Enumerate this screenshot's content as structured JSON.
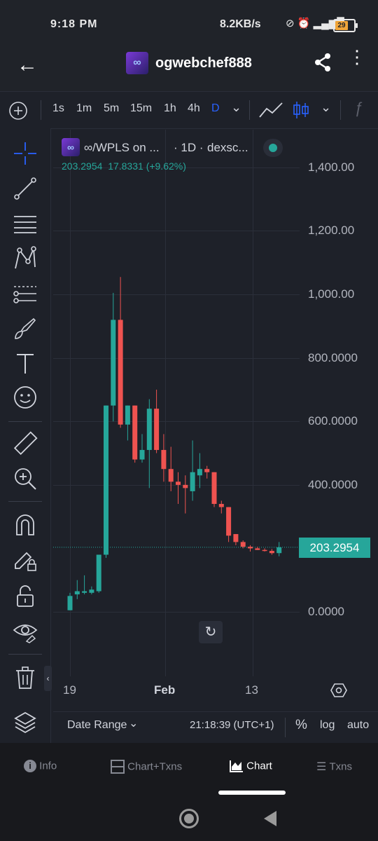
{
  "status": {
    "time": "9:18 PM",
    "network_speed": "8.2KB/s",
    "battery": "29"
  },
  "header": {
    "title": "ogwebchef888",
    "logo_text": "∞"
  },
  "toolbar": {
    "intervals": [
      "1s",
      "1m",
      "5m",
      "15m",
      "1h",
      "4h",
      "D"
    ],
    "active_interval": "D"
  },
  "legend": {
    "symbol": "∞/WPLS on ...",
    "interval": "· 1D ·",
    "source": "dexsc...",
    "last": "203.2954",
    "change": "17.8331",
    "change_pct": "(+9.62%)"
  },
  "price_tag": "203.2954",
  "bottom_bar": {
    "date_range": "Date Range",
    "clock": "21:18:39 (UTC+1)",
    "percent": "%",
    "log": "log",
    "auto": "auto"
  },
  "nav": {
    "info": "Info",
    "chart_txns": "Chart+Txns",
    "chart": "Chart",
    "txns": "Txns"
  },
  "colors": {
    "up": "#26a69a",
    "down": "#ef5350",
    "active_interval": "#2962ff"
  },
  "chart_data": {
    "type": "candlestick",
    "x_tick_labels": [
      "19",
      "Feb",
      "13"
    ],
    "y_tick_labels": [
      "1,400.00",
      "1,200.00",
      "1,000.00",
      "800.0000",
      "600.0000",
      "400.0000",
      "0.0000"
    ],
    "ylim": [
      0,
      1400
    ],
    "last_price": 203.2954,
    "candles": [
      {
        "o": 5,
        "h": 60,
        "l": 5,
        "c": 50
      },
      {
        "o": 55,
        "h": 100,
        "l": 40,
        "c": 65
      },
      {
        "o": 60,
        "h": 115,
        "l": 55,
        "c": 65
      },
      {
        "o": 60,
        "h": 80,
        "l": 55,
        "c": 70
      },
      {
        "o": 65,
        "h": 180,
        "l": 60,
        "c": 180
      },
      {
        "o": 180,
        "h": 300,
        "l": 170,
        "c": 650
      },
      {
        "o": 650,
        "h": 1005,
        "l": 600,
        "c": 920
      },
      {
        "o": 920,
        "h": 1055,
        "l": 580,
        "c": 590
      },
      {
        "o": 590,
        "h": 650,
        "l": 540,
        "c": 650
      },
      {
        "o": 650,
        "h": 640,
        "l": 470,
        "c": 480
      },
      {
        "o": 480,
        "h": 560,
        "l": 470,
        "c": 510
      },
      {
        "o": 510,
        "h": 670,
        "l": 390,
        "c": 640
      },
      {
        "o": 640,
        "h": 700,
        "l": 500,
        "c": 510
      },
      {
        "o": 510,
        "h": 560,
        "l": 410,
        "c": 450
      },
      {
        "o": 450,
        "h": 520,
        "l": 380,
        "c": 410
      },
      {
        "o": 410,
        "h": 440,
        "l": 340,
        "c": 400
      },
      {
        "o": 400,
        "h": 430,
        "l": 310,
        "c": 390
      },
      {
        "o": 380,
        "h": 540,
        "l": 350,
        "c": 440
      },
      {
        "o": 430,
        "h": 500,
        "l": 390,
        "c": 450
      },
      {
        "o": 450,
        "h": 460,
        "l": 420,
        "c": 440
      },
      {
        "o": 440,
        "h": 420,
        "l": 330,
        "c": 340
      },
      {
        "o": 340,
        "h": 350,
        "l": 310,
        "c": 330
      },
      {
        "o": 330,
        "h": 330,
        "l": 220,
        "c": 240
      },
      {
        "o": 245,
        "h": 235,
        "l": 210,
        "c": 220
      },
      {
        "o": 220,
        "h": 225,
        "l": 200,
        "c": 205
      },
      {
        "o": 205,
        "h": 210,
        "l": 190,
        "c": 200
      },
      {
        "o": 200,
        "h": 205,
        "l": 195,
        "c": 195
      },
      {
        "o": 195,
        "h": 200,
        "l": 190,
        "c": 192
      },
      {
        "o": 192,
        "h": 198,
        "l": 180,
        "c": 185
      },
      {
        "o": 185,
        "h": 220,
        "l": 175,
        "c": 203.3
      }
    ]
  }
}
